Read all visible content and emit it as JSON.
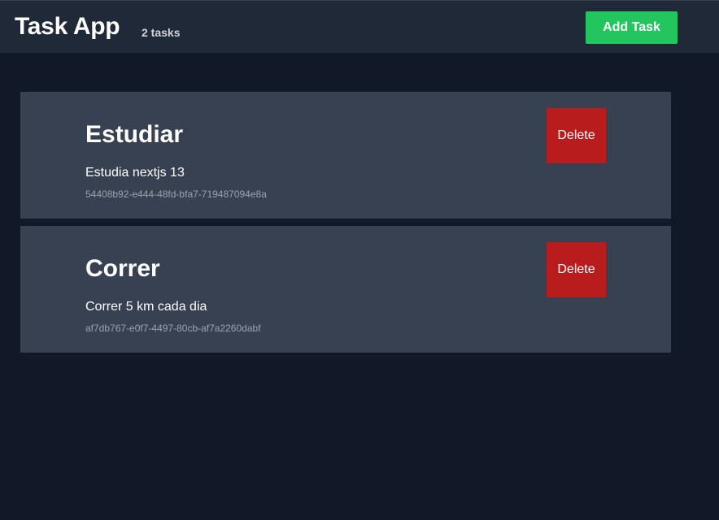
{
  "header": {
    "title": "Task App",
    "task_count": "2 tasks",
    "add_task_label": "Add Task"
  },
  "tasks": [
    {
      "title": "Estudiar",
      "description": "Estudia nextjs 13",
      "id": "54408b92-e444-48fd-bfa7-719487094e8a",
      "delete_label": "Delete"
    },
    {
      "title": "Correr",
      "description": "Correr 5 km cada dia",
      "id": "af7db767-e0f7-4497-80cb-af7a2260dabf",
      "delete_label": "Delete"
    }
  ],
  "colors": {
    "background": "#111827",
    "header": "#1f2937",
    "card": "#374151",
    "add_button": "#22c55e",
    "delete_button": "#b91c1c"
  }
}
